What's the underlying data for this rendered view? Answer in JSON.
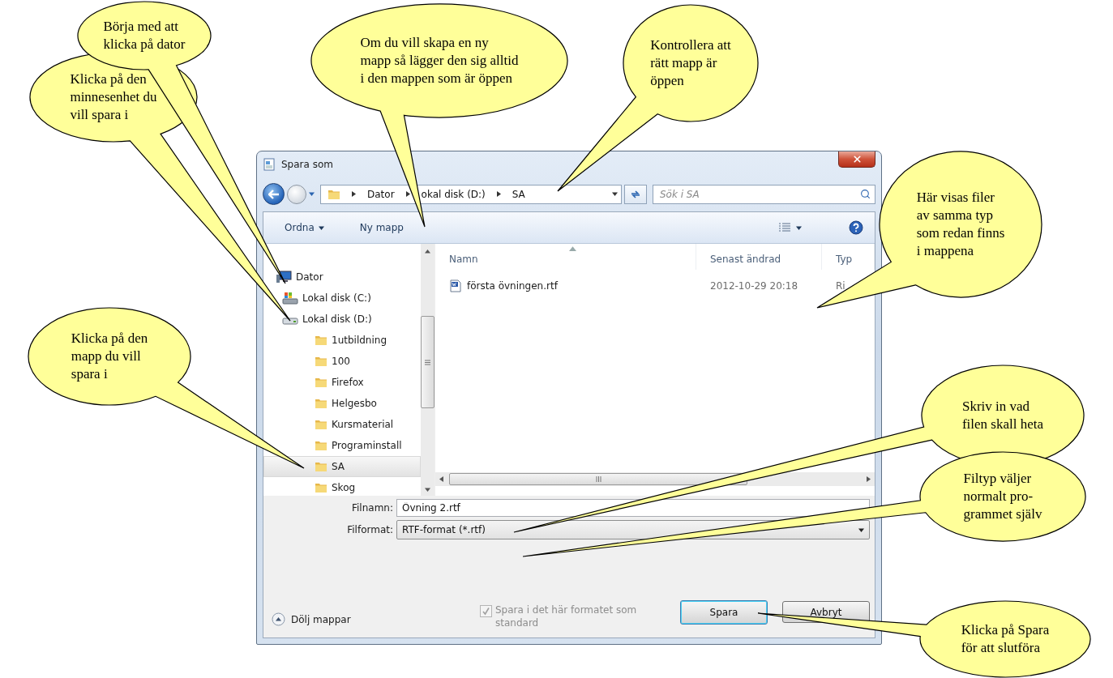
{
  "window": {
    "title": "Spara som"
  },
  "address": {
    "crumbs": [
      "Dator",
      "okal disk (D:)",
      "SA"
    ]
  },
  "search": {
    "placeholder": "Sök i SA"
  },
  "toolbar": {
    "organize": "Ordna",
    "new_folder": "Ny mapp"
  },
  "navigation": [
    {
      "label": "Dator",
      "kind": "computer",
      "selected": false,
      "children": [
        {
          "label": "Lokal disk (C:)",
          "kind": "system-drive",
          "selected": false
        },
        {
          "label": "Lokal disk (D:)",
          "kind": "drive",
          "selected": false,
          "children": [
            {
              "label": "1utbildning",
              "kind": "folder",
              "selected": false
            },
            {
              "label": "100",
              "kind": "folder",
              "selected": false
            },
            {
              "label": "Firefox",
              "kind": "folder",
              "selected": false
            },
            {
              "label": "Helgesbo",
              "kind": "folder",
              "selected": false
            },
            {
              "label": "Kursmaterial",
              "kind": "folder",
              "selected": false
            },
            {
              "label": "Programinstall",
              "kind": "folder",
              "selected": false
            },
            {
              "label": "SA",
              "kind": "folder",
              "selected": true
            },
            {
              "label": "Skog",
              "kind": "folder",
              "selected": false
            }
          ]
        }
      ]
    }
  ],
  "columns": [
    "Namn",
    "Senast ändrad",
    "Typ"
  ],
  "files": [
    {
      "name": "första övningen.rtf",
      "modified": "2012-10-29 20:18",
      "type": "Ri"
    }
  ],
  "form": {
    "filename_label": "Filnamn:",
    "filename": "Övning 2.rtf",
    "format_label": "Filformat:",
    "format": "RTF-format (*.rtf)"
  },
  "default_checkbox": {
    "label": "Spara i det här formatet som standard",
    "checked": true,
    "disabled": true
  },
  "buttons": [
    {
      "label": "Spara",
      "default": true
    },
    {
      "label": "Avbryt",
      "default": false
    }
  ],
  "hide_folders": "Dölj mappar",
  "callouts": [
    {
      "text": "Börja med att\nklicka på dator"
    },
    {
      "text": "Om du vill skapa en ny\nmapp så lägger den sig alltid\ni den mappen som är öppen"
    },
    {
      "text": "Kontrollera att\nrätt mapp är\nöppen"
    },
    {
      "text": "Här visas filer\nav samma typ\nsom redan finns\ni mappena"
    },
    {
      "text": "Klicka på den\nminnesenhet du\nvill spara i"
    },
    {
      "text": "Klicka på den\nmapp du vill\nspara i"
    },
    {
      "text": "Skriv in vad\nfilen skall heta"
    },
    {
      "text": "Filtyp väljer\nnormalt pro-\ngrammet själv"
    },
    {
      "text": "Klicka på Spara\nför att slutföra"
    }
  ]
}
